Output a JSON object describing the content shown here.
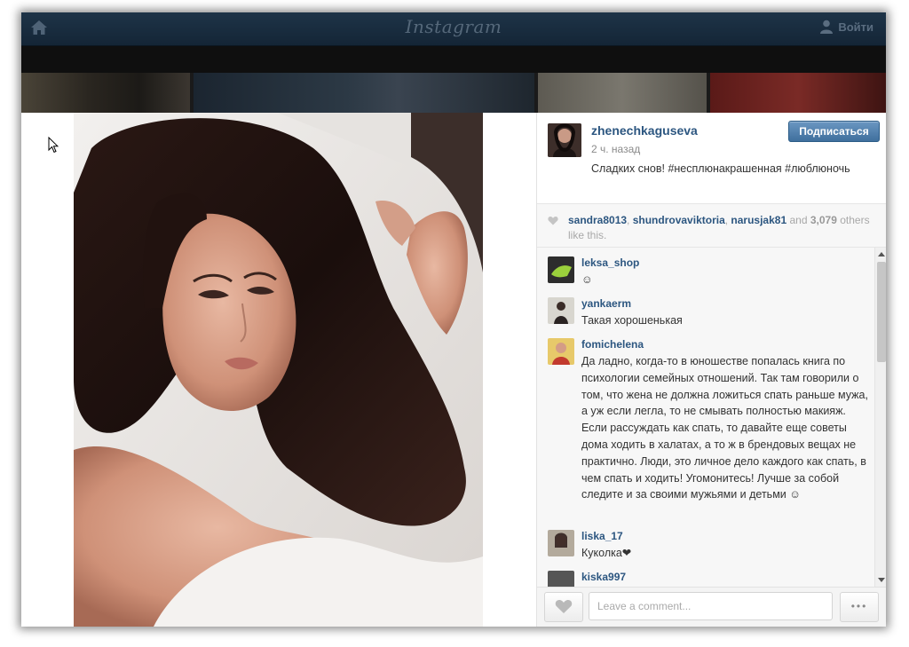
{
  "header": {
    "brand": "Instagram",
    "login_label": "Войти"
  },
  "post": {
    "username": "zhenechkaguseva",
    "time_ago": "2 ч. назад",
    "caption_text": "Сладких снов!",
    "caption_emoji": "",
    "caption_tags": "#несплюнакрашенная #люблюночь",
    "follow_label": "Подписаться"
  },
  "likes": {
    "likers": [
      "sandra8013",
      "shundrovaviktoria",
      "narusjak81"
    ],
    "and_label": "and",
    "count": "3,079",
    "suffix": "others like this."
  },
  "comments": [
    {
      "user": "leksa_shop",
      "text": "☺"
    },
    {
      "user": "yankaerm",
      "text": "Такая хорошенькая"
    },
    {
      "user": "fomichelena",
      "text": "Да ладно, когда-то в юношестве попалась книга по психологии семейных отношений. Так там говорили о том, что жена не должна ложиться спать раньше мужа, а уж если легла, то не смывать полностью макияж. Если рассуждать как спать, то давайте еще советы дома ходить в халатах, а то ж в брендовых вещах не практично. Люди, это личное дело каждого как спать, в чем спать и ходить! Угомонитесь! Лучше за собой следите и за своими мужьями и детьми ☺"
    },
    {
      "user": "liska_17",
      "text": "Куколка❤"
    },
    {
      "user": "kiska997",
      "text": ""
    }
  ],
  "footer": {
    "comment_placeholder": "Leave a comment...",
    "more_label": "•••"
  }
}
